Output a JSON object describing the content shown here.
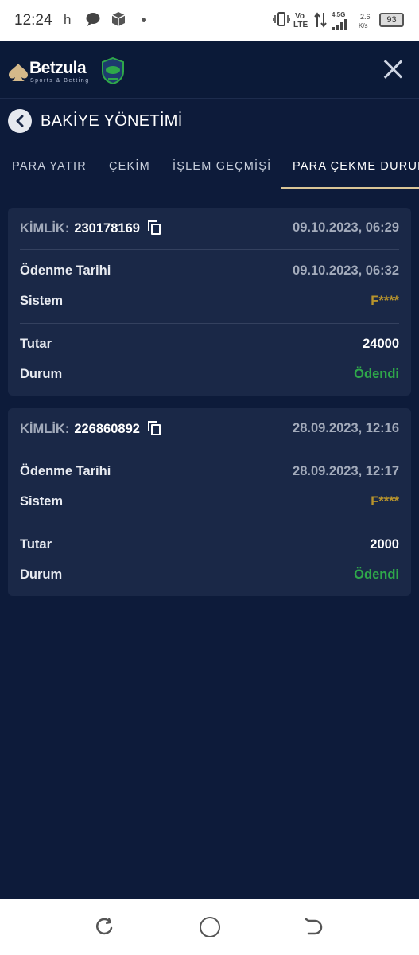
{
  "status_bar": {
    "time": "12:24",
    "notif_h": "h",
    "signal_label": "4.5G",
    "volte_top": "Vo",
    "volte_bottom": "LTE",
    "speed_top": "2.6",
    "speed_bottom": "K/s",
    "battery": "93"
  },
  "header": {
    "brand": "Betzula",
    "tagline": "Sports & Betting",
    "close_icon": "close-icon"
  },
  "page": {
    "title": "BAKİYE YÖNETİMİ"
  },
  "tabs": [
    {
      "label": "PARA YATIR"
    },
    {
      "label": "ÇEKİM"
    },
    {
      "label": "İŞLEM GEÇMİŞİ"
    },
    {
      "label": "PARA ÇEKME DURUMU"
    }
  ],
  "active_tab": "PARA ÇEKME DURUMU",
  "labels": {
    "id": "KİMLİK:",
    "paid_date": "Ödenme Tarihi",
    "system": "Sistem",
    "amount": "Tutar",
    "status": "Durum"
  },
  "withdrawals": [
    {
      "id": "230178169",
      "created": "09.10.2023, 06:29",
      "paid_date": "09.10.2023, 06:32",
      "system": "F****",
      "amount": "24000",
      "status": "Ödendi"
    },
    {
      "id": "226860892",
      "created": "28.09.2023, 12:16",
      "paid_date": "28.09.2023, 12:17",
      "system": "F****",
      "amount": "2000",
      "status": "Ödendi"
    }
  ],
  "colors": {
    "background": "#0d1b3a",
    "card": "#1a2847",
    "accent_gold": "#d9c597",
    "system_gold": "#b8942c",
    "status_green": "#2fa84a"
  }
}
